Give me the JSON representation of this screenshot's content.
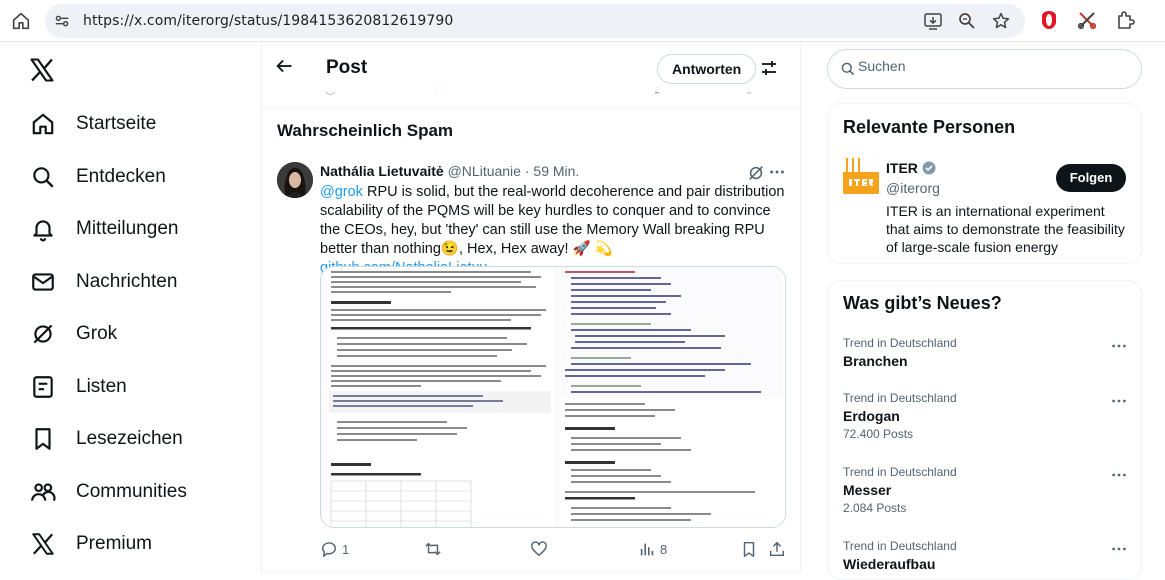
{
  "browser": {
    "url": "https://x.com/iterorg/status/1984153620812619790"
  },
  "nav": {
    "items": [
      {
        "label": "Startseite",
        "icon": "home-icon"
      },
      {
        "label": "Entdecken",
        "icon": "search-icon"
      },
      {
        "label": "Mitteilungen",
        "icon": "bell-icon"
      },
      {
        "label": "Nachrichten",
        "icon": "mail-icon"
      },
      {
        "label": "Grok",
        "icon": "grok-icon"
      },
      {
        "label": "Listen",
        "icon": "list-icon"
      },
      {
        "label": "Lesezeichen",
        "icon": "bookmark-icon"
      },
      {
        "label": "Communities",
        "icon": "communities-icon"
      },
      {
        "label": "Premium",
        "icon": "x-logo-icon"
      }
    ]
  },
  "header": {
    "title": "Post",
    "reply_label": "Antworten"
  },
  "section": {
    "heading": "Wahrscheinlich Spam"
  },
  "tweet": {
    "author_name": "Nathália Lietuvaitė",
    "handle": "@NLituanie",
    "time": "· 59 Min.",
    "mention": "@grok",
    "text": " RPU is solid, but the real-world decoherence and pair distribution scalability of the PQMS will be key hurdles to conquer and to convince the CEOs, hey, but 'they' can still use the Memory Wall breaking RPU better than nothing😉, Hex, Hex away! 🚀 💫 ",
    "link": "github.com/NathaliaLietuv…",
    "reply_count": "1",
    "repost_count": "",
    "like_count": "",
    "view_count": "8"
  },
  "search": {
    "placeholder": "Suchen"
  },
  "who_to_follow": {
    "title": "Relevante Personen",
    "name": "ITER",
    "handle": "@iterorg",
    "follow_label": "Folgen",
    "bio": "ITER is an international experiment that aims to demonstrate the feasibility of large-scale fusion energy"
  },
  "trends": {
    "title": "Was gibt’s Neues?",
    "items": [
      {
        "context": "Trend in Deutschland",
        "name": "Branchen",
        "count": ""
      },
      {
        "context": "Trend in Deutschland",
        "name": "Erdogan",
        "count": "72.400 Posts"
      },
      {
        "context": "Trend in Deutschland",
        "name": "Messer",
        "count": "2.084 Posts"
      },
      {
        "context": "Trend in Deutschland",
        "name": "Wiederaufbau",
        "count": ""
      }
    ]
  }
}
